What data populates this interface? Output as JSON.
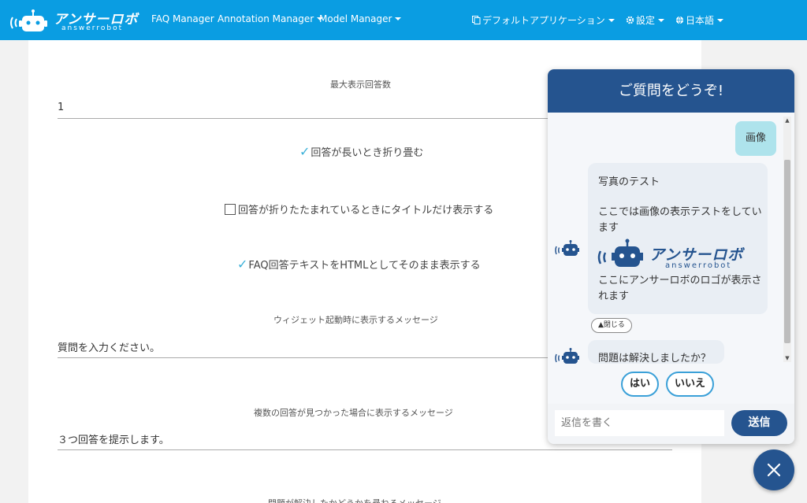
{
  "navbar": {
    "brand_name": "アンサーロボ",
    "brand_sub": "answerrobot",
    "faq_manager": "FAQ Manager",
    "annotation_manager": "Annotation Manager",
    "model_manager": "Model Manager",
    "default_app": "デフォルトアプリケーション",
    "settings": "設定",
    "language": "日本語"
  },
  "form": {
    "max_answers_label": "最大表示回答数",
    "max_answers_value": "1",
    "collapse_long_label": "回答が長いとき折り畳む",
    "collapse_long_checked": true,
    "title_only_label": "回答が折りたたまれているときにタイトルだけ表示する",
    "title_only_checked": false,
    "html_raw_label": "FAQ回答テキストをHTMLとしてそのまま表示する",
    "html_raw_checked": true,
    "startup_msg_label": "ウィジェット起動時に表示するメッセージ",
    "startup_msg_value": "質問を入力ください。",
    "multiple_msg_label": "複数の回答が見つかった場合に表示するメッセージ",
    "multiple_msg_value": "３つ回答を提示します。",
    "resolved_msg_label": "問題が解決したかどうかを尋ねるメッセージ"
  },
  "chat": {
    "header_title": "ご質問をどうぞ!",
    "user_message": "画像",
    "bot_message_title": "写真のテスト",
    "bot_message_body": "ここでは画像の表示テストをしています",
    "bot_logo_name": "アンサーロボ",
    "bot_logo_sub": "answerrobot",
    "bot_message_after": "ここにアンサーロボのロゴが表示されます",
    "close_label": "▲閉じる",
    "resolved_question": "問題は解決しましたか？",
    "yes_label": "はい",
    "no_label": "いいえ",
    "reply_placeholder": "返信を書く",
    "send_label": "送信"
  },
  "colors": {
    "navbar": "#0a9de2",
    "chat_header": "#25548f",
    "user_bubble": "#aee3ec",
    "bot_bubble": "#e9eef4",
    "check": "#3ab0d8"
  }
}
